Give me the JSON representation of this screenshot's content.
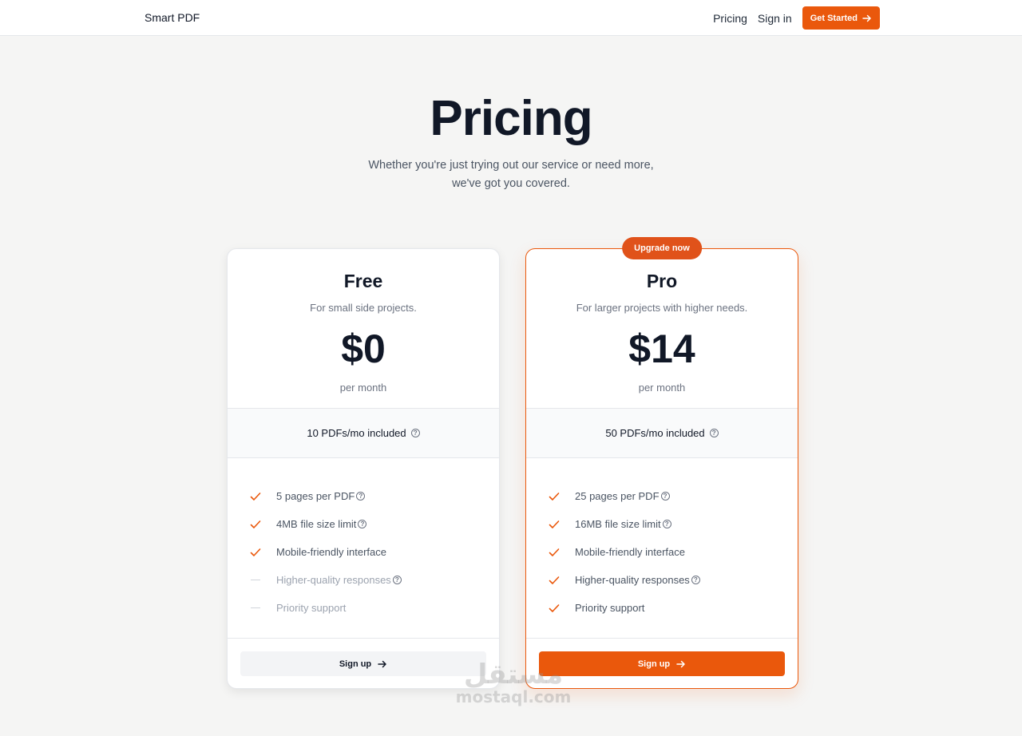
{
  "navbar": {
    "brand": "Smart PDF",
    "links": [
      "Pricing",
      "Sign in"
    ],
    "cta": "Get Started"
  },
  "hero": {
    "title": "Pricing",
    "subtitle_line1": "Whether you're just trying out our service or need more,",
    "subtitle_line2": "we've got you covered."
  },
  "plans": [
    {
      "name": "Free",
      "description": "For small side projects.",
      "price": "$0",
      "period": "per month",
      "quota": "10 PDFs/mo included",
      "features": [
        {
          "text": "5 pages per PDF",
          "included": true,
          "help": true
        },
        {
          "text": "4MB file size limit",
          "included": true,
          "help": true
        },
        {
          "text": "Mobile-friendly interface",
          "included": true,
          "help": false
        },
        {
          "text": "Higher-quality responses",
          "included": false,
          "help": true
        },
        {
          "text": "Priority support",
          "included": false,
          "help": false
        }
      ],
      "button": "Sign up"
    },
    {
      "name": "Pro",
      "badge": "Upgrade now",
      "description": "For larger projects with higher needs.",
      "price": "$14",
      "period": "per month",
      "quota": "50 PDFs/mo included",
      "features": [
        {
          "text": "25 pages per PDF",
          "included": true,
          "help": true
        },
        {
          "text": "16MB file size limit",
          "included": true,
          "help": true
        },
        {
          "text": "Mobile-friendly interface",
          "included": true,
          "help": false
        },
        {
          "text": "Higher-quality responses",
          "included": true,
          "help": true
        },
        {
          "text": "Priority support",
          "included": true,
          "help": false
        }
      ],
      "button": "Sign up"
    }
  ],
  "watermark": {
    "arabic": "مستقل",
    "latin": "mostaql.com"
  },
  "colors": {
    "accent": "#ea580c",
    "text": "#111827",
    "muted": "#6b7280",
    "background": "#f5f5f4"
  },
  "icons": [
    "arrow-right-icon",
    "check-icon",
    "help-circle-icon",
    "dash-icon"
  ]
}
